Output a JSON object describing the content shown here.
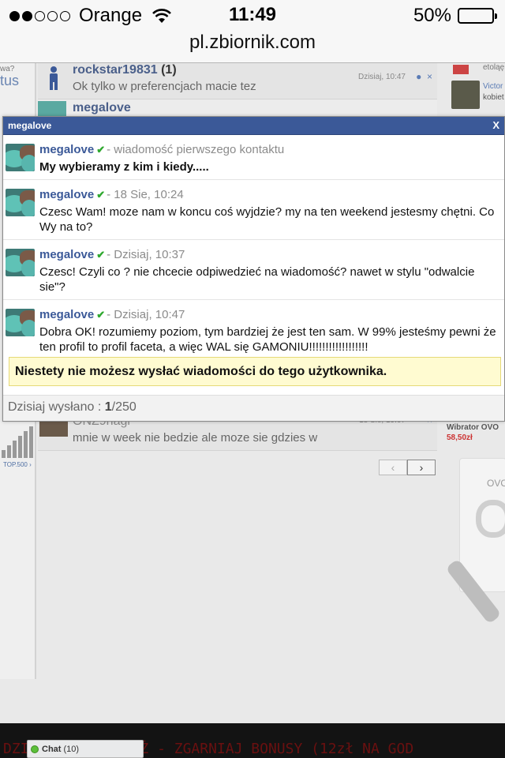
{
  "status_bar": {
    "carrier": "Orange",
    "time": "11:49",
    "battery": "50%",
    "battery_level": 0.5,
    "signal_bars": 2
  },
  "url": "pl.zbiornik.com",
  "background": {
    "left_question": "wa?",
    "left_status": "tus",
    "top500": "TOP.500 ›",
    "rows": [
      {
        "name": "rockstar19831",
        "count": "(1)",
        "message": "Ok tylko w preferencjach macie tez",
        "date": "Dzisiaj, 10:47"
      },
      {
        "name": "megalove"
      },
      {
        "name": "ONZ9nagi",
        "message": "mnie w week nie bedzie ale moze sie gdzies w",
        "date": "18 Sie, 19:07"
      }
    ],
    "right_top": {
      "text1": "etoląę",
      "text2": "Victor",
      "text3": "kobiet"
    },
    "product": {
      "name": "Wibrator OVO",
      "price": "58,50zł",
      "label": "OVO"
    },
    "pager": {
      "prev": "‹",
      "next": "›"
    }
  },
  "modal": {
    "title": "megalove",
    "close": "X",
    "messages": [
      {
        "name": "megalove",
        "check": "✔",
        "meta": "- wiadomość pierwszego kontaktu",
        "text": "My wybieramy z kim i kiedy....."
      },
      {
        "name": "megalove",
        "check": "✔",
        "meta": "- 18 Sie, 10:24",
        "text": "Czesc Wam! moze nam w koncu coś wyjdzie? my na ten weekend jestesmy chętni. Co Wy na to?"
      },
      {
        "name": "megalove",
        "check": "✔",
        "meta": "- Dzisiaj, 10:37",
        "text": "Czesc! Czyli co ? nie chcecie odpiwedzieć na wiadomość? nawet w stylu \"odwalcie sie\"?"
      },
      {
        "name": "megalove",
        "check": "✔",
        "meta": "- Dzisiaj, 10:47",
        "text": "Dobra OK! rozumiemy poziom, tym bardziej że jest ten sam. W 99% jesteśmy pewni że ten profil to profil faceta, a więc WAL się GAMONIU!!!!!!!!!!!!!!!!!!"
      }
    ],
    "notice": "Niestety nie możesz wysłać wiadomości do tego użytkownika.",
    "footer_label": "Dzisiaj wysłano :",
    "footer_sent": "1",
    "footer_limit": "/250"
  },
  "ticker": "DZI                    OBOTNI MELANŻ - ZGARNIAJ BONUSY (12zł NA GOD",
  "chat": {
    "label": "Chat",
    "count": "(10)"
  },
  "colors": {
    "header_blue": "#3b5998",
    "notice_bg": "#fffbd1",
    "check_green": "#2fa82f"
  }
}
